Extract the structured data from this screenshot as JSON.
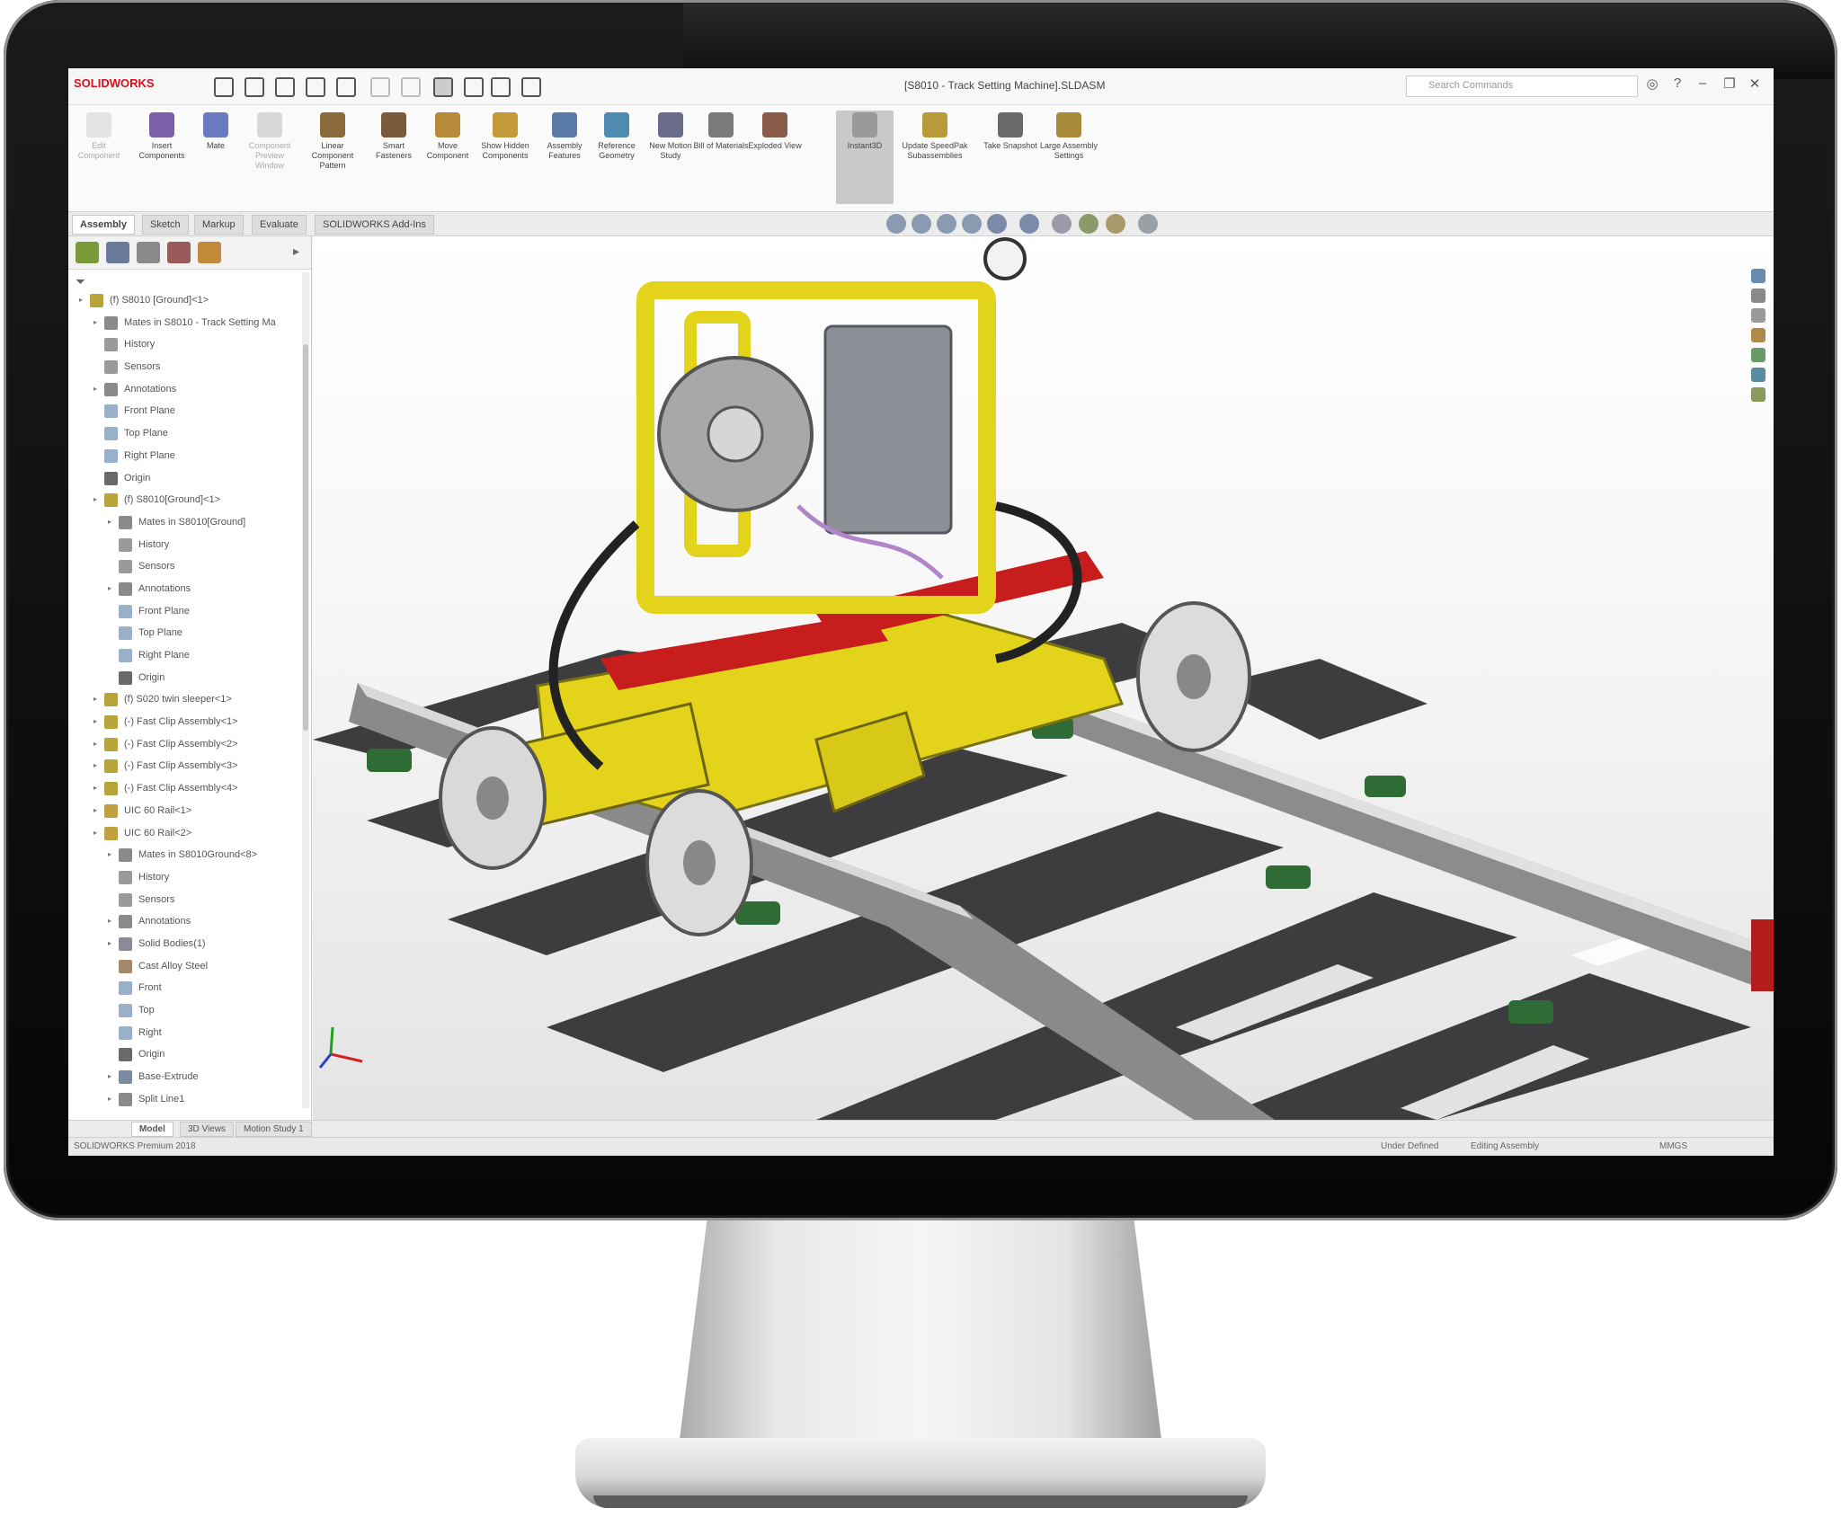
{
  "app": {
    "logo_text": "SOLIDWORKS",
    "document_title": "[S8010 - Track Setting Machine].SLDASM",
    "search_placeholder": "Search Commands"
  },
  "ribbon": {
    "buttons": [
      {
        "label": "Edit Component",
        "icon": "edit-component-icon",
        "enabled": false
      },
      {
        "label": "Insert Components",
        "icon": "insert-components-icon",
        "enabled": true
      },
      {
        "label": "Mate",
        "icon": "mate-icon",
        "enabled": true
      },
      {
        "label": "Component Preview Window",
        "icon": "component-preview-icon",
        "enabled": false
      },
      {
        "label": "Linear Component Pattern",
        "icon": "linear-pattern-icon",
        "enabled": true
      },
      {
        "label": "Smart Fasteners",
        "icon": "smart-fasteners-icon",
        "enabled": true
      },
      {
        "label": "Move Component",
        "icon": "move-component-icon",
        "enabled": true
      },
      {
        "label": "Show Hidden Components",
        "icon": "show-hidden-icon",
        "enabled": true
      },
      {
        "label": "Assembly Features",
        "icon": "assembly-features-icon",
        "enabled": true
      },
      {
        "label": "Reference Geometry",
        "icon": "reference-geometry-icon",
        "enabled": true
      },
      {
        "label": "New Motion Study",
        "icon": "motion-study-icon",
        "enabled": true
      },
      {
        "label": "Bill of Materials",
        "icon": "bill-of-materials-icon",
        "enabled": true
      },
      {
        "label": "Exploded View",
        "icon": "exploded-view-icon",
        "enabled": true
      },
      {
        "label": "Instant3D",
        "icon": "instant3d-icon",
        "enabled": true,
        "active": true
      },
      {
        "label": "Update SpeedPak Subassemblies",
        "icon": "speedpak-icon",
        "enabled": true
      },
      {
        "label": "Take Snapshot",
        "icon": "snapshot-icon",
        "enabled": true
      },
      {
        "label": "Large Assembly Settings",
        "icon": "large-assembly-icon",
        "enabled": true
      }
    ]
  },
  "command_tabs": [
    "Assembly",
    "Sketch",
    "Markup",
    "Evaluate",
    "SOLIDWORKS Add-Ins"
  ],
  "feature_tree": [
    {
      "label": "(f) S8010 [Ground]<1>",
      "icon": "assembly-icon"
    },
    {
      "label": "Mates in S8010 - Track Setting Ma",
      "icon": "mates-icon"
    },
    {
      "label": "History",
      "icon": "history-icon"
    },
    {
      "label": "Sensors",
      "icon": "sensors-icon"
    },
    {
      "label": "Annotations",
      "icon": "annotations-icon"
    },
    {
      "label": "Front Plane",
      "icon": "plane-icon"
    },
    {
      "label": "Top Plane",
      "icon": "plane-icon"
    },
    {
      "label": "Right Plane",
      "icon": "plane-icon"
    },
    {
      "label": "Origin",
      "icon": "origin-icon"
    },
    {
      "label": "(f) S8010[Ground]<1>",
      "icon": "assembly-icon"
    },
    {
      "label": "Mates in S8010[Ground]",
      "icon": "mates-icon"
    },
    {
      "label": "History",
      "icon": "history-icon"
    },
    {
      "label": "Sensors",
      "icon": "sensors-icon"
    },
    {
      "label": "Annotations",
      "icon": "annotations-icon"
    },
    {
      "label": "Front Plane",
      "icon": "plane-icon"
    },
    {
      "label": "Top Plane",
      "icon": "plane-icon"
    },
    {
      "label": "Right Plane",
      "icon": "plane-icon"
    },
    {
      "label": "Origin",
      "icon": "origin-icon"
    },
    {
      "label": "(f) S020 twin sleeper<1>",
      "icon": "assembly-icon"
    },
    {
      "label": "(-) Fast Clip Assembly<1>",
      "icon": "assembly-icon"
    },
    {
      "label": "(-) Fast Clip Assembly<2>",
      "icon": "assembly-icon"
    },
    {
      "label": "(-) Fast Clip Assembly<3>",
      "icon": "assembly-icon"
    },
    {
      "label": "(-) Fast Clip Assembly<4>",
      "icon": "assembly-icon"
    },
    {
      "label": "UIC 60 Rail<1>",
      "icon": "part-icon"
    },
    {
      "label": "UIC 60 Rail<2>",
      "icon": "part-icon"
    },
    {
      "label": "Mates in S8010Ground<8>",
      "icon": "mates-icon"
    },
    {
      "label": "History",
      "icon": "history-icon"
    },
    {
      "label": "Sensors",
      "icon": "sensors-icon"
    },
    {
      "label": "Annotations",
      "icon": "annotations-icon"
    },
    {
      "label": "Solid Bodies(1)",
      "icon": "solid-bodies-icon"
    },
    {
      "label": "Cast Alloy Steel",
      "icon": "material-icon"
    },
    {
      "label": "Front",
      "icon": "plane-icon"
    },
    {
      "label": "Top",
      "icon": "plane-icon"
    },
    {
      "label": "Right",
      "icon": "plane-icon"
    },
    {
      "label": "Origin",
      "icon": "origin-icon"
    },
    {
      "label": "Base-Extrude",
      "icon": "extrude-icon"
    },
    {
      "label": "Split Line1",
      "icon": "split-line-icon"
    }
  ],
  "bottom_tabs": [
    "Model",
    "3D Views",
    "Motion Study 1"
  ],
  "status": {
    "product": "SOLIDWORKS Premium 2018",
    "definition": "Under Defined",
    "mode": "Editing Assembly",
    "units": "MMGS"
  },
  "colors": {
    "brand": "#d8101a",
    "machine": "#e3d31a",
    "accent_red": "#c81d1d",
    "fastener_green": "#2f6b35"
  }
}
